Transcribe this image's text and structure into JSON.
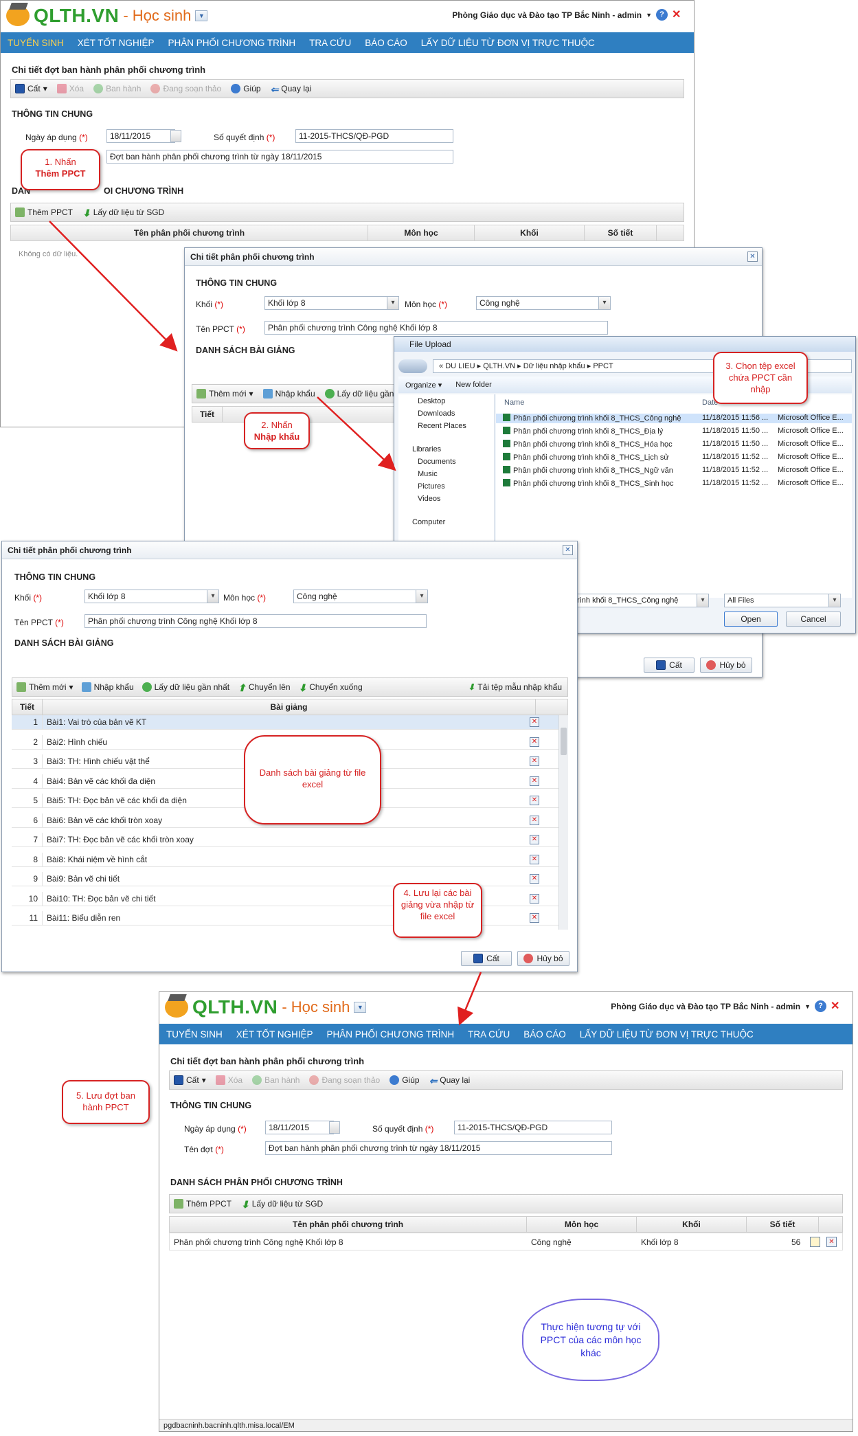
{
  "app": {
    "brand": "QLTH.VN",
    "sub": "- Học sinh",
    "org_user": "Phòng Giáo dục và Đào tạo TP Bắc Ninh - admin",
    "nav": [
      "TUYỂN SINH",
      "XÉT TỐT NGHIỆP",
      "PHÂN PHỐI CHƯƠNG TRÌNH",
      "TRA CỨU",
      "BÁO CÁO",
      "LẤY DỮ LIỆU TỪ ĐƠN VỊ TRỰC THUỘC"
    ],
    "status_url": "pgdbacninh.bacninh.qlth.misa.local/EM"
  },
  "batch": {
    "title": "Chi tiết đợt ban hành phân phối chương trình",
    "toolbar": {
      "save": "Cất",
      "delete": "Xóa",
      "issue": "Ban hành",
      "drafting": "Đang soạn thảo",
      "help": "Giúp",
      "back": "Quay lại"
    },
    "general": "THÔNG TIN CHUNG",
    "date_label": "Ngày áp dụng",
    "date_value": "18/11/2015",
    "decision_label": "Số quyết định",
    "decision_value": "11-2015-THCS/QĐ-PGD",
    "name_label": "Tên đợt",
    "name_value": "Đợt ban hành phân phối chương trình từ ngày 18/11/2015",
    "list_title": "DANH SÁCH PHÂN PHỐI CHƯƠNG TRÌNH",
    "list_title_partial": "OI CHƯƠNG TRÌNH",
    "list_title_prefix": "DAN",
    "add_ppct": "Thêm PPCT",
    "get_sgd": "Lấy dữ liệu từ SGD",
    "cols": [
      "Tên phân phối chương trình",
      "Môn học",
      "Khối",
      "Số tiết"
    ],
    "empty": "Không có dữ liệu.",
    "result_row": {
      "name": "Phân phối chương trình Công nghệ Khối lớp 8",
      "subject": "Công nghệ",
      "grade": "Khối lớp 8",
      "periods": "56"
    }
  },
  "ppct": {
    "title": "Chi tiết phân phối chương trình",
    "general": "THÔNG TIN CHUNG",
    "grade_label": "Khối",
    "grade_value": "Khối lớp 8",
    "subject_label": "Môn học",
    "subject_value": "Công nghệ",
    "name_label": "Tên PPCT",
    "name_value": "Phân phối chương trình Công nghệ Khối lớp 8",
    "lessons_title": "DANH SÁCH BÀI GIẢNG",
    "add_new": "Thêm mới",
    "import": "Nhập khẩu",
    "get_latest": "Lấy dữ liệu gần nhất",
    "get_partial": "Lấy dữ liệu gần",
    "move_up": "Chuyển lên",
    "move_down": "Chuyển xuống",
    "template": "Tải tệp mẫu nhập khẩu",
    "col_period": "Tiết",
    "col_lesson": "Bài giảng",
    "save": "Cất",
    "cancel": "Hủy bỏ",
    "lessons": [
      {
        "n": "1",
        "t": "Bài1: Vai trò của bản vẽ KT"
      },
      {
        "n": "2",
        "t": "Bài2: Hình chiếu"
      },
      {
        "n": "3",
        "t": "Bài3: TH: Hình chiếu vật thể"
      },
      {
        "n": "4",
        "t": "Bài4: Bản vẽ các khối đa diện"
      },
      {
        "n": "5",
        "t": "Bài5: TH: Đọc bản vẽ các khối đa diện"
      },
      {
        "n": "6",
        "t": "Bài6: Bản vẽ các khối tròn xoay"
      },
      {
        "n": "7",
        "t": "Bài7: TH: Đọc bản vẽ các khối tròn xoay"
      },
      {
        "n": "8",
        "t": "Bài8: Khái niệm về hình cắt"
      },
      {
        "n": "9",
        "t": "Bài9: Bản vẽ chi tiết"
      },
      {
        "n": "10",
        "t": "Bài10: TH: Đọc bản vẽ chi tiết"
      },
      {
        "n": "11",
        "t": "Bài11: Biểu diễn ren"
      }
    ]
  },
  "file_upload": {
    "title": "File Upload",
    "path": [
      "DU LIEU",
      "QLTH.VN",
      "Dữ liệu nhập khẩu",
      "PPCT"
    ],
    "organize": "Organize",
    "new_folder": "New folder",
    "tree": [
      "Desktop",
      "Downloads",
      "Recent Places",
      "Libraries",
      "Documents",
      "Music",
      "Pictures",
      "Videos",
      "Computer"
    ],
    "col_name": "Name",
    "col_date": "Date",
    "files": [
      {
        "name": "Phân phối chương trình khối 8_THCS_Công nghệ",
        "date": "11/18/2015 11:56 ...",
        "type": "Microsoft Office E..."
      },
      {
        "name": "Phân phối chương trình khối 8_THCS_Địa lý",
        "date": "11/18/2015 11:50 ...",
        "type": "Microsoft Office E..."
      },
      {
        "name": "Phân phối chương trình khối 8_THCS_Hóa học",
        "date": "11/18/2015 11:50 ...",
        "type": "Microsoft Office E..."
      },
      {
        "name": "Phân phối chương trình khối 8_THCS_Lịch sử",
        "date": "11/18/2015 11:52 ...",
        "type": "Microsoft Office E..."
      },
      {
        "name": "Phân phối chương trình khối 8_THCS_Ngữ văn",
        "date": "11/18/2015 11:52 ...",
        "type": "Microsoft Office E..."
      },
      {
        "name": "Phân phối chương trình khối 8_THCS_Sinh học",
        "date": "11/18/2015 11:52 ...",
        "type": "Microsoft Office E..."
      }
    ],
    "filename_value": "trình khối 8_THCS_Công nghệ",
    "filter": "All Files",
    "open": "Open",
    "cancel": "Cancel"
  },
  "callouts": {
    "c1a": "1. Nhấn",
    "c1b": "Thêm PPCT",
    "c2a": "2. Nhấn",
    "c2b": "Nhập khẩu",
    "c3": "3. Chọn tệp excel chứa PPCT cần nhập",
    "c_list": "Danh sách bài giảng từ file excel",
    "c4": "4. Lưu lại các bài giảng vừa nhập từ file excel",
    "c5": "5. Lưu đợt ban hành PPCT",
    "cloud": "Thực hiện tương tự với PPCT của các môn học khác"
  }
}
